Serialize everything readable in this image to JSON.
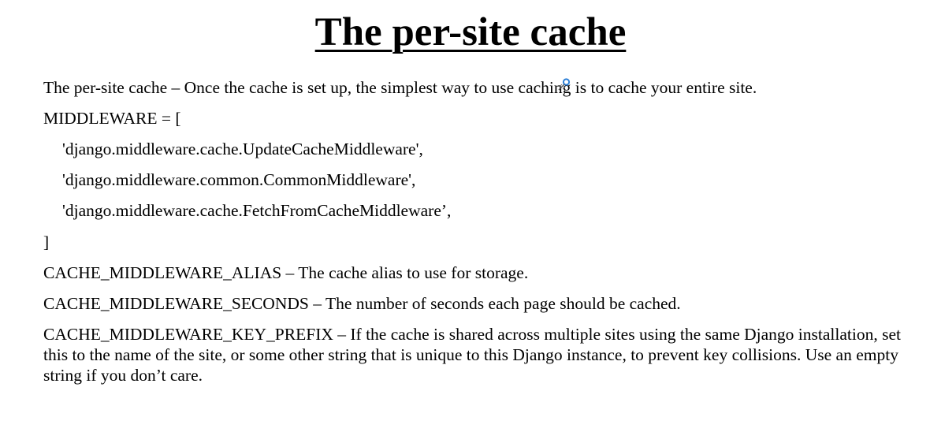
{
  "title": "The per-site cache",
  "intro": "The per-site cache – Once the cache is set up, the simplest way to use caching is to cache your entire site.",
  "code": {
    "open": "MIDDLEWARE = [",
    "lines": [
      "'django.middleware.cache.UpdateCacheMiddleware',",
      "'django.middleware.common.CommonMiddleware',",
      "'django.middleware.cache.FetchFromCacheMiddleware’,"
    ],
    "close": "]"
  },
  "settings": {
    "alias": "CACHE_MIDDLEWARE_ALIAS – The cache alias to use for storage.",
    "seconds": "CACHE_MIDDLEWARE_SECONDS – The number of seconds each page should be cached.",
    "key_prefix": "CACHE_MIDDLEWARE_KEY_PREFIX – If the cache is shared across multiple sites using the same Django installation, set this to the name of the site, or some other string that is unique to this Django instance, to prevent key collisions. Use an empty string if you don’t care."
  },
  "icons": {
    "cursor": "pen-cursor-icon"
  },
  "colors": {
    "text": "#000000",
    "background": "#ffffff",
    "cursor_accent": "#2b7fd6"
  }
}
